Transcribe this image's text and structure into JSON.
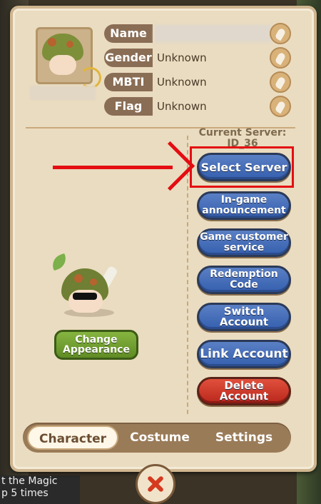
{
  "profile": {
    "fields": [
      {
        "label": "Name",
        "value": ""
      },
      {
        "label": "Gender",
        "value": "Unknown"
      },
      {
        "label": "MBTI",
        "value": "Unknown"
      },
      {
        "label": "Flag",
        "value": "Unknown"
      }
    ]
  },
  "server": {
    "label": "Current Server:",
    "id": "ID_36"
  },
  "menu": [
    {
      "label": "Select Server"
    },
    {
      "label": "In-game announcement"
    },
    {
      "label": "Game customer service"
    },
    {
      "label": "Redemption Code"
    },
    {
      "label": "Switch Account"
    },
    {
      "label": "Link Account"
    },
    {
      "label": "Delete Account"
    }
  ],
  "appearance": {
    "button_label": "Change Appearance"
  },
  "tabs": [
    {
      "label": "Character"
    },
    {
      "label": "Costume"
    },
    {
      "label": "Settings"
    }
  ],
  "background_text": "t the Magic\np 5 times",
  "colors": {
    "highlight": "#e40d12",
    "menu_blue": "#355fae",
    "menu_red": "#b9271c",
    "appearance_green": "#5f8b24"
  },
  "icons": {
    "edit": "feather-quill-icon",
    "refresh": "refresh-arrows-icon",
    "close": "close-x-icon"
  }
}
